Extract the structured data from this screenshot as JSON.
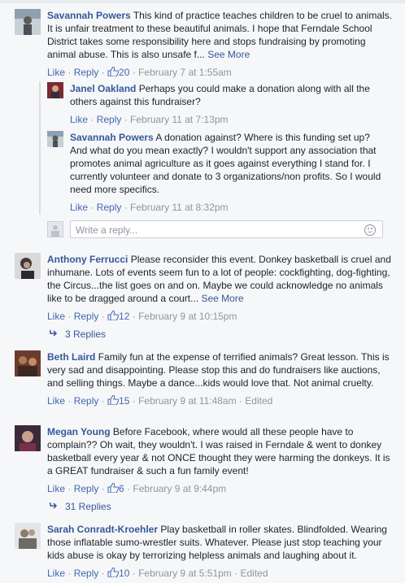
{
  "ui": {
    "like": "Like",
    "reply": "Reply",
    "see_more": "See More",
    "dot": " · "
  },
  "comments": [
    {
      "name": "Savannah Powers",
      "text": "This kind of practice teaches children to be cruel to animals. It is unfair treatment to these beautiful animals. I hope that Ferndale School District takes some responsibility here and stops fundraising by promoting animal abuse. This is also unsafe f...",
      "likes": "20",
      "time": "February 7 at 1:55am",
      "replies": [
        {
          "name": "Janel Oakland",
          "text": "Perhaps you could make a donation along with all the others against this fundraiser?",
          "time": "February 11 at 7:13pm"
        },
        {
          "name": "Savannah Powers",
          "text": "A donation against? Where is this funding set up? And what do you mean exactly? I wouldn't support any association that promotes animal agriculture as it goes against everything I stand for. I currently volunteer and donate to 3 organizations/non profits. So I would need more specifics.",
          "time": "February 11 at 8:32pm"
        }
      ]
    },
    {
      "name": "Anthony Ferrucci",
      "text": "Please reconsider this event. Donkey basketball is cruel and inhumane. Lots of events seem fun to a lot of people: cockfighting, dog-fighting, the Circus...the list goes on and on. Maybe we could acknowledge no animals like to be dragged around a court...",
      "likes": "12",
      "time": "February 9 at 10:15pm",
      "replies_count": "3 Replies"
    },
    {
      "name": "Beth Laird",
      "text": "Family fun at the expense of terrified animals? Great lesson. This is very sad and disappointing. Please stop this and do fundraisers like auctions, and selling things. Maybe a dance...kids would love that. Not animal cruelty.",
      "likes": "15",
      "time": "February 9 at 11:48am",
      "edited": "Edited"
    },
    {
      "name": "Megan Young",
      "text": "Before Facebook, where would all these people have to complain?? Oh wait, they wouldn't. I was raised in Ferndale & went to donkey basketball every year & not ONCE thought they were harming the donkeys. It is a GREAT fundraiser & such a fun family event!",
      "likes": "6",
      "time": "February 9 at 9:44pm",
      "replies_count": "31 Replies"
    },
    {
      "name": "Sarah Conradt-Kroehler",
      "text": "Play basketball in roller skates. Blindfolded. Wearing those inflatable sumo-wrestler suits. Whatever. Please just stop teaching your kids abuse is okay by terrorizing helpless animals and laughing about it.",
      "likes": "10",
      "time": "February 9 at 5:51pm",
      "edited": "Edited"
    }
  ],
  "reply_box": {
    "placeholder": "Write a reply..."
  },
  "colors": {
    "link": "#365899",
    "meta": "#90949c",
    "background": "#f6f7f9"
  }
}
